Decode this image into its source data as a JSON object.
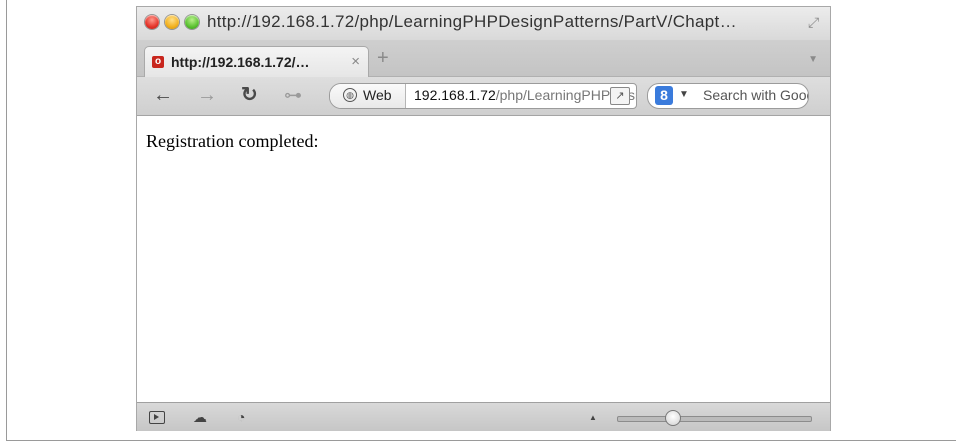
{
  "window": {
    "title": "http://192.168.1.72/php/LearningPHPDesignPatterns/PartV/Chapt…"
  },
  "tabs": [
    {
      "label": "http://192.168.1.72/…",
      "favicon": "o",
      "close": "×"
    }
  ],
  "tabbar": {
    "new_tab": "+"
  },
  "toolbar": {
    "web_label": "Web",
    "url_host": "192.168.1.72",
    "url_path": "/php/LearningPHPDesignPatterns/PartV/Chapter",
    "search_engine": "8",
    "search_placeholder": "Search with Google"
  },
  "content": {
    "text": "Registration completed:"
  },
  "statusbar": {
    "zoom_level": 0.28
  },
  "colors": {
    "close": "#e4352b",
    "minimize": "#f2b11f",
    "zoom": "#5cc232",
    "search_badge": "#3a7bdc"
  }
}
